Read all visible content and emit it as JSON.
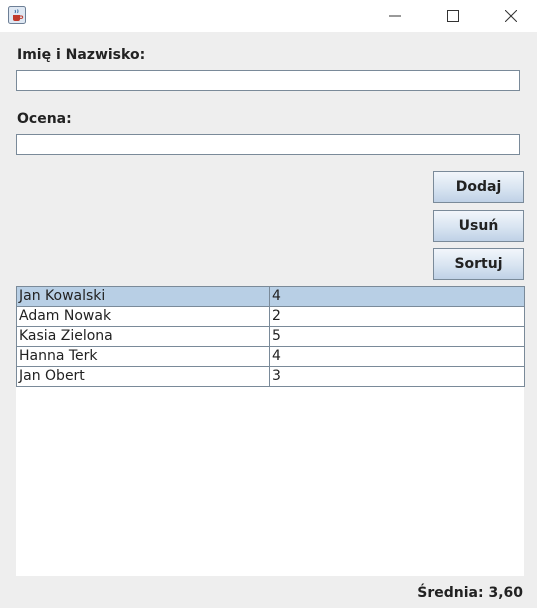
{
  "window": {
    "icons": {
      "app": "java-cup-icon",
      "minimize": "minimize-icon",
      "maximize": "maximize-icon",
      "close": "close-icon"
    }
  },
  "form": {
    "name_label": "Imię i Nazwisko:",
    "name_value": "",
    "grade_label": "Ocena:",
    "grade_value": ""
  },
  "buttons": {
    "add": "Dodaj",
    "remove": "Usuń",
    "sort": "Sortuj"
  },
  "table": {
    "selected_row": 0,
    "rows": [
      {
        "name": "Jan Kowalski",
        "grade": "4"
      },
      {
        "name": "Adam Nowak",
        "grade": "2"
      },
      {
        "name": "Kasia Zielona",
        "grade": "5"
      },
      {
        "name": "Hanna Terk",
        "grade": "4"
      },
      {
        "name": "Jan Obert",
        "grade": "3"
      }
    ]
  },
  "footer": {
    "average": "Średnia: 3,60"
  },
  "colors": {
    "selection": "#b8cfe5",
    "border": "#7a8a99",
    "background": "#eeeeee"
  }
}
